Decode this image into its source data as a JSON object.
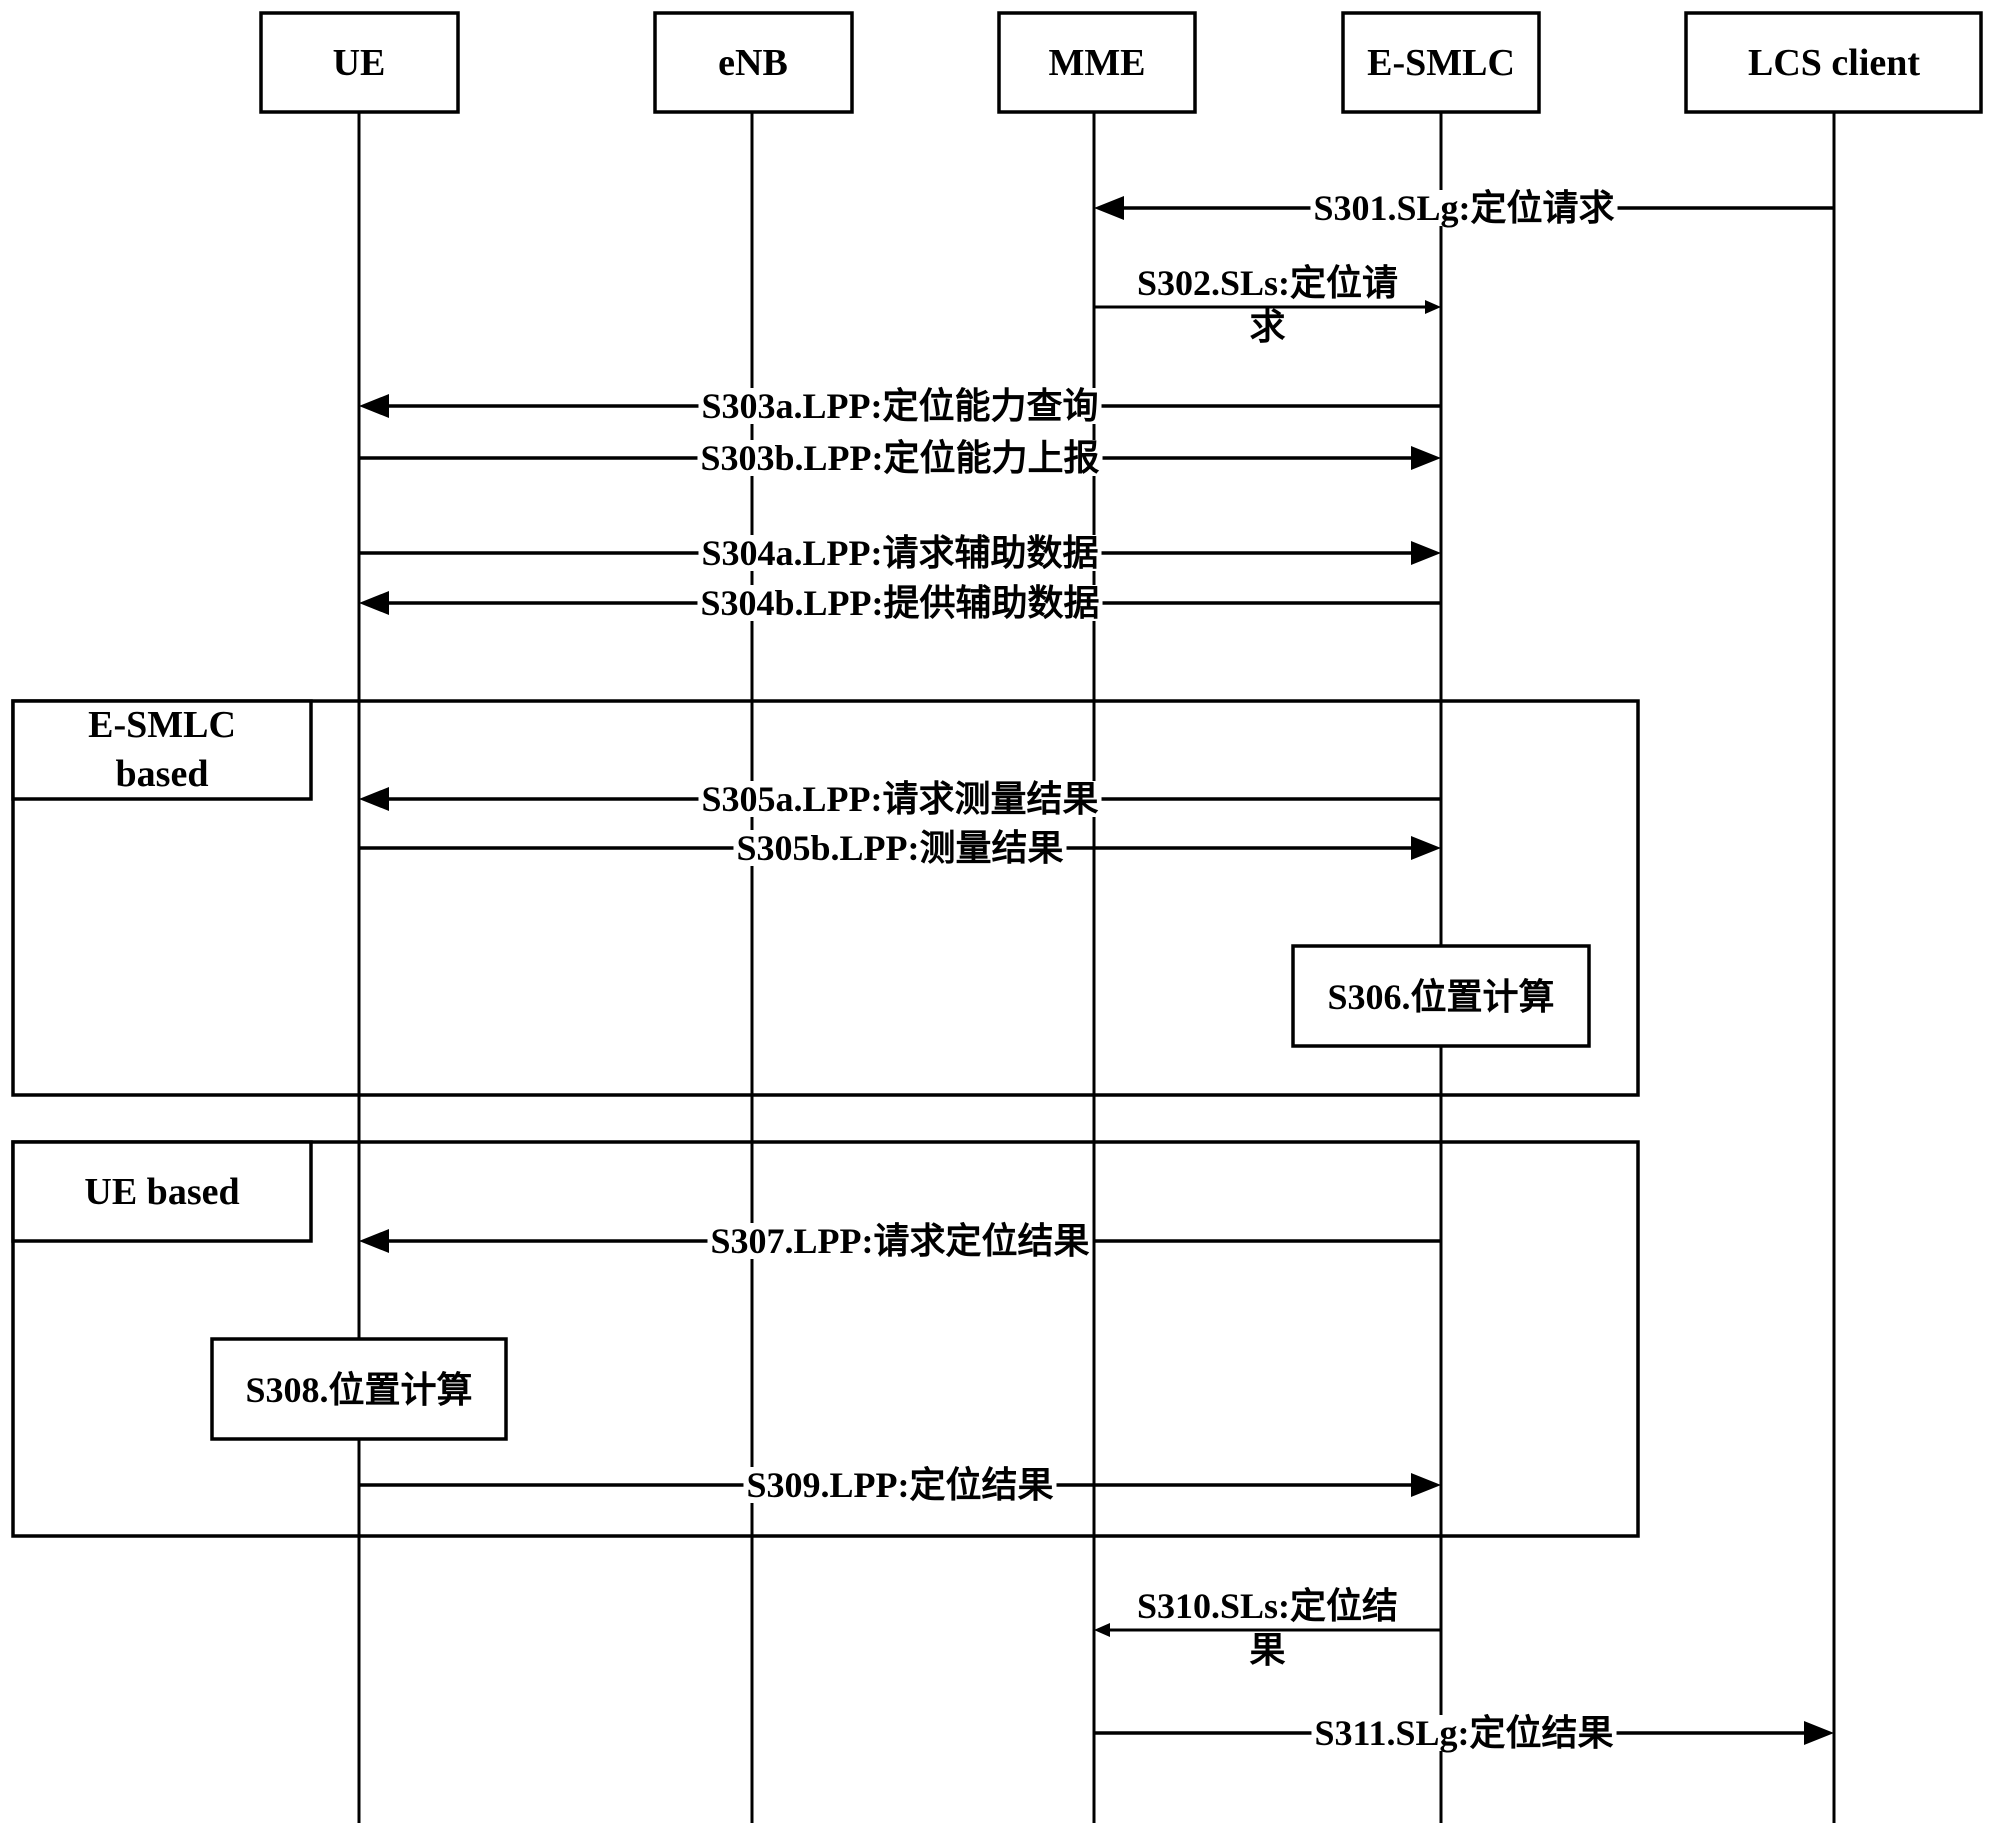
{
  "diagram": {
    "type": "sequence-diagram",
    "participants": [
      {
        "id": "ue",
        "label": "UE"
      },
      {
        "id": "enb",
        "label": "eNB"
      },
      {
        "id": "mme",
        "label": "MME"
      },
      {
        "id": "esmlc",
        "label": "E-SMLC"
      },
      {
        "id": "lcs",
        "label": "LCS client"
      }
    ],
    "messages": [
      {
        "id": "s301",
        "from": "lcs",
        "to": "mme",
        "label": "S301.SLg:定位请求",
        "lines": [
          "S301.SLg:定位请求"
        ]
      },
      {
        "id": "s302",
        "from": "mme",
        "to": "esmlc",
        "label": "S302.SLs:定位请求",
        "lines": [
          "S302.SLs:定位请",
          "求"
        ]
      },
      {
        "id": "s303a",
        "from": "esmlc",
        "to": "ue",
        "label": "S303a.LPP:定位能力查询",
        "lines": [
          "S303a.LPP:定位能力查询"
        ]
      },
      {
        "id": "s303b",
        "from": "ue",
        "to": "esmlc",
        "label": "S303b.LPP:定位能力上报",
        "lines": [
          "S303b.LPP:定位能力上报"
        ]
      },
      {
        "id": "s304a",
        "from": "ue",
        "to": "esmlc",
        "label": "S304a.LPP:请求辅助数据",
        "lines": [
          "S304a.LPP:请求辅助数据"
        ]
      },
      {
        "id": "s304b",
        "from": "esmlc",
        "to": "ue",
        "label": "S304b.LPP:提供辅助数据",
        "lines": [
          "S304b.LPP:提供辅助数据"
        ]
      },
      {
        "id": "s305a",
        "from": "esmlc",
        "to": "ue",
        "label": "S305a.LPP:请求测量结果",
        "lines": [
          "S305a.LPP:请求测量结果"
        ]
      },
      {
        "id": "s305b",
        "from": "ue",
        "to": "esmlc",
        "label": "S305b.LPP:测量结果",
        "lines": [
          "S305b.LPP:测量结果"
        ]
      },
      {
        "id": "s307",
        "from": "esmlc",
        "to": "ue",
        "label": "S307.LPP:请求定位结果",
        "lines": [
          "S307.LPP:请求定位结果"
        ]
      },
      {
        "id": "s309",
        "from": "ue",
        "to": "esmlc",
        "label": "S309.LPP:定位结果",
        "lines": [
          "S309.LPP:定位结果"
        ]
      },
      {
        "id": "s310",
        "from": "esmlc",
        "to": "mme",
        "label": "S310.SLs:定位结果",
        "lines": [
          "S310.SLs:定位结",
          "果"
        ]
      },
      {
        "id": "s311",
        "from": "mme",
        "to": "lcs",
        "label": "S311.SLg:定位结果",
        "lines": [
          "S311.SLg:定位结果"
        ]
      }
    ],
    "frames": [
      {
        "id": "esmlc-based",
        "label_lines": [
          "E-SMLC",
          "based"
        ]
      },
      {
        "id": "ue-based",
        "label_lines": [
          "UE based"
        ]
      }
    ],
    "activities": [
      {
        "id": "s306",
        "on": "esmlc",
        "label": "S306.位置计算"
      },
      {
        "id": "s308",
        "on": "ue",
        "label": "S308.位置计算"
      }
    ]
  }
}
